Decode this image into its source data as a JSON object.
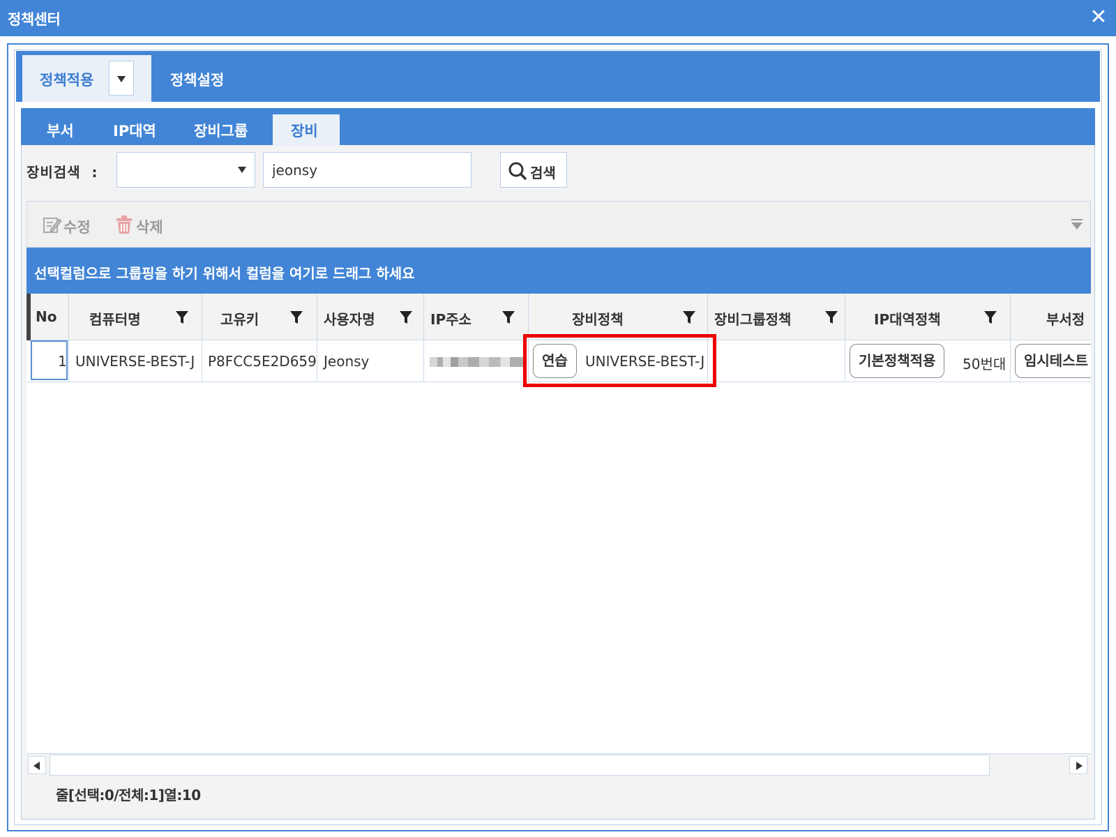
{
  "window": {
    "title": "정책센터",
    "close_glyph": "✕"
  },
  "main_tabs": [
    {
      "label": "정책적용",
      "active": true
    },
    {
      "label": "정책설정",
      "active": false
    }
  ],
  "sub_tabs": [
    {
      "label": "부서",
      "active": false
    },
    {
      "label": "IP대역",
      "active": false
    },
    {
      "label": "장비그룹",
      "active": false
    },
    {
      "label": "장비",
      "active": true
    }
  ],
  "search": {
    "label": "장비검색",
    "separator": ":",
    "select_value": "",
    "input_value": "jeonsy",
    "button_label": "검색"
  },
  "toolbar": {
    "edit_label": "수정",
    "delete_label": "삭제"
  },
  "group_bar": {
    "text": "선택컬럼으로 그룹핑을 하기 위해서 컬럼을 여기로 드래그 하세요"
  },
  "grid": {
    "columns": [
      "No",
      "컴퓨터명",
      "고유키",
      "사용자명",
      "IP주소",
      "장비정책",
      "장비그룹정책",
      "IP대역정책",
      "부서정"
    ],
    "rows": [
      {
        "no": "1",
        "computer_name": "UNIVERSE-BEST-J",
        "unique_key": "P8FCC5E2D659",
        "user_name": "Jeonsy",
        "device_policy_badge": "연습",
        "device_policy_text": "UNIVERSE-BEST-J",
        "device_group_policy": "",
        "ip_range_badge": "기본정책적용",
        "ip_range_text": "50번대",
        "dept_badge": "임시테스트"
      }
    ]
  },
  "status": "줄[선택:0/전체:1]열:10",
  "colors": {
    "accent": "#4285d6",
    "highlight": "#ee0000",
    "active_tab_bg": "#e9f0f8"
  }
}
